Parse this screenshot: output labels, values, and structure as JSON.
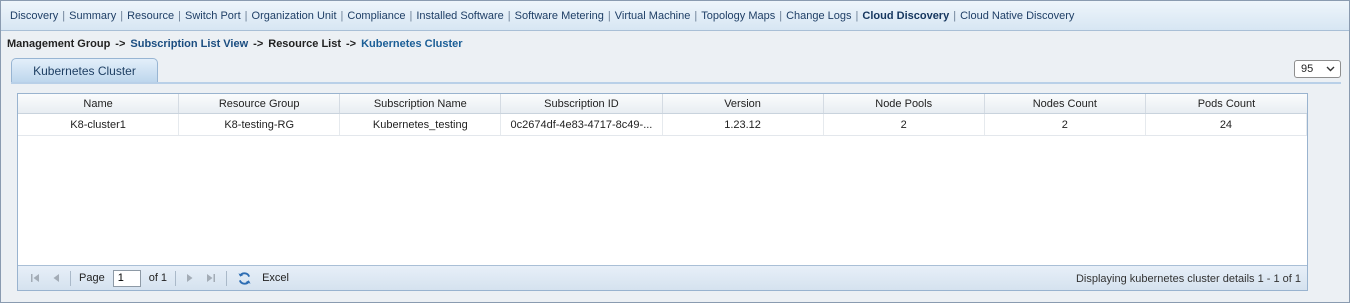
{
  "topnav": {
    "items": [
      {
        "label": "Discovery"
      },
      {
        "label": "Summary"
      },
      {
        "label": "Resource"
      },
      {
        "label": "Switch Port"
      },
      {
        "label": "Organization Unit"
      },
      {
        "label": "Compliance"
      },
      {
        "label": "Installed Software"
      },
      {
        "label": "Software Metering"
      },
      {
        "label": "Virtual Machine"
      },
      {
        "label": "Topology Maps"
      },
      {
        "label": "Change Logs"
      },
      {
        "label": "Cloud Discovery"
      },
      {
        "label": "Cloud Native Discovery"
      }
    ],
    "separator": "|"
  },
  "breadcrumb": {
    "items": [
      "Management Group",
      "Subscription List View",
      "Resource List",
      "Kubernetes Cluster"
    ],
    "arrow": "->"
  },
  "tab": {
    "label": "Kubernetes Cluster"
  },
  "page_size": {
    "value": "95"
  },
  "grid": {
    "columns": [
      "Name",
      "Resource Group",
      "Subscription Name",
      "Subscription ID",
      "Version",
      "Node Pools",
      "Nodes Count",
      "Pods Count"
    ],
    "rows": [
      [
        "K8-cluster1",
        "K8-testing-RG",
        "Kubernetes_testing",
        "0c2674df-4e83-4717-8c49-...",
        "1.23.12",
        "2",
        "2",
        "24"
      ]
    ]
  },
  "toolbar": {
    "page_label": "Page",
    "page_value": "1",
    "of_label": "of 1",
    "excel_label": "Excel",
    "status": "Displaying kubernetes cluster details 1 - 1 of 1"
  },
  "colors": {
    "nav_bg": "#d7e6f3",
    "link": "#1b4d80",
    "current": "#1b5e96",
    "tab_bg": "#bcd5ec",
    "grid_border": "#99b3cf"
  }
}
